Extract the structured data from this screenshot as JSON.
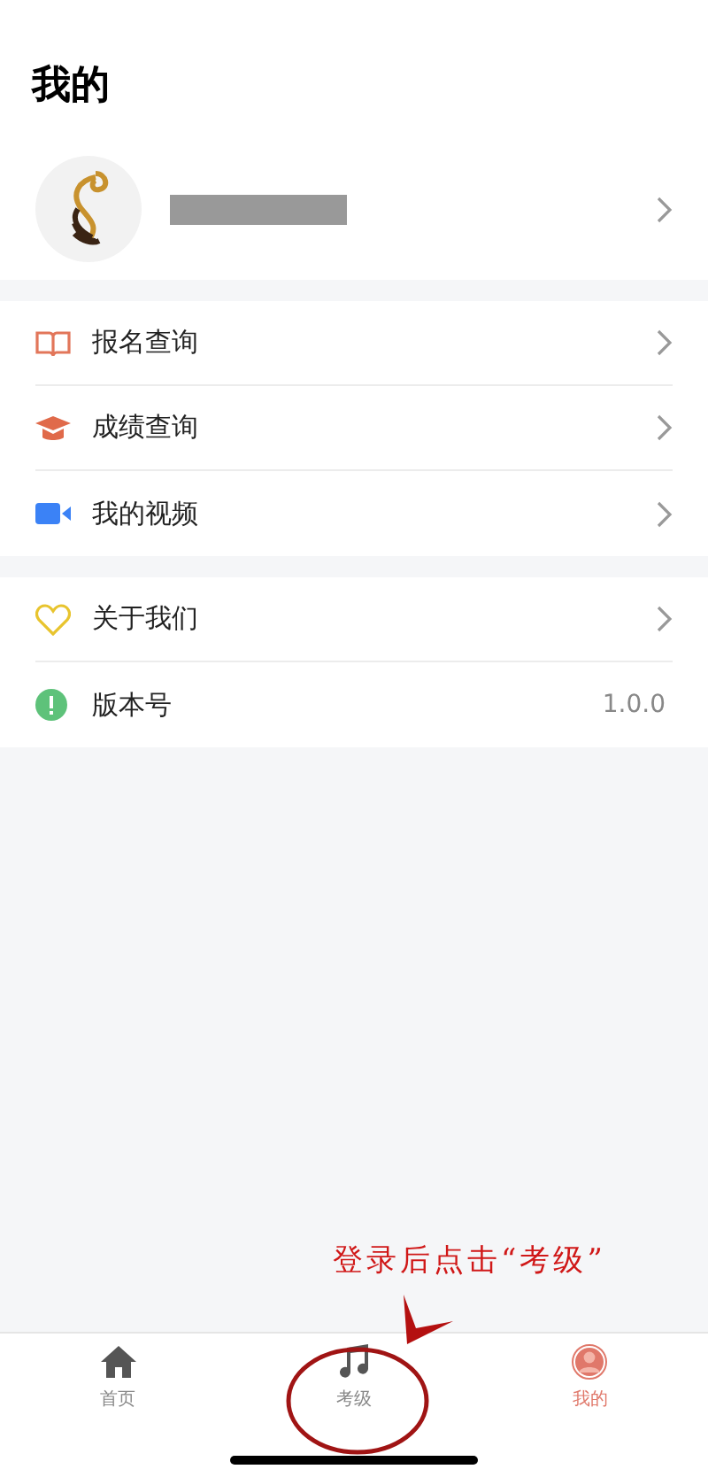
{
  "header": {
    "title": "我的"
  },
  "profile": {
    "name_redacted": true
  },
  "menu_groups": [
    {
      "items": [
        {
          "kind": "link",
          "label": "报名查询"
        },
        {
          "kind": "link",
          "label": "成绩查询"
        },
        {
          "kind": "link",
          "label": "我的视频"
        }
      ]
    },
    {
      "items": [
        {
          "kind": "link",
          "label": "关于我们"
        },
        {
          "kind": "info",
          "label": "版本号",
          "value": "1.0.0"
        }
      ]
    }
  ],
  "annotation": {
    "text": "登录后点击“考级”"
  },
  "tab_bar": [
    {
      "label": "首页",
      "selected": false
    },
    {
      "label": "考级",
      "selected": false
    },
    {
      "label": "我的",
      "selected": true
    }
  ]
}
